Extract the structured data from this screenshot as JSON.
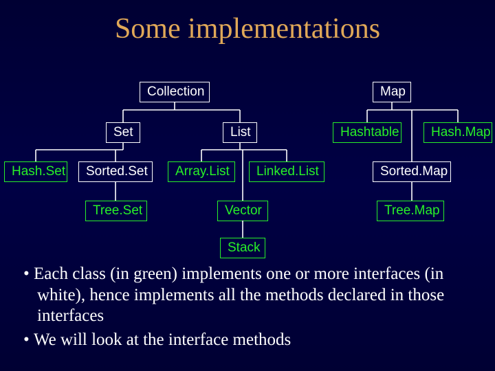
{
  "title": "Some implementations",
  "nodes": {
    "collection": "Collection",
    "map": "Map",
    "set": "Set",
    "list": "List",
    "hashset": "Hash.Set",
    "sortedset": "Sorted.Set",
    "arraylist": "Array.List",
    "linkedlist": "Linked.List",
    "treeset": "Tree.Set",
    "vector": "Vector",
    "stack": "Stack",
    "hashtable": "Hashtable",
    "hashmap": "Hash.Map",
    "sortedmap": "Sorted.Map",
    "treemap": "Tree.Map"
  },
  "bullets": [
    "Each class (in green) implements one or more interfaces (in white), hence implements all the methods declared in those interfaces",
    "We will look at the interface methods"
  ],
  "chart_data": {
    "type": "hierarchy",
    "legend": {
      "white": "interface",
      "green": "class"
    },
    "edges": [
      [
        "Collection",
        "Set"
      ],
      [
        "Collection",
        "List"
      ],
      [
        "Set",
        "Hash.Set"
      ],
      [
        "Set",
        "Sorted.Set"
      ],
      [
        "Sorted.Set",
        "Tree.Set"
      ],
      [
        "List",
        "Array.List"
      ],
      [
        "List",
        "Linked.List"
      ],
      [
        "List",
        "Vector"
      ],
      [
        "Vector",
        "Stack"
      ],
      [
        "Map",
        "Hashtable"
      ],
      [
        "Map",
        "Hash.Map"
      ],
      [
        "Map",
        "Sorted.Map"
      ],
      [
        "Sorted.Map",
        "Tree.Map"
      ]
    ],
    "interfaces": [
      "Collection",
      "Map",
      "Set",
      "List",
      "Sorted.Set",
      "Sorted.Map"
    ],
    "classes": [
      "Hash.Set",
      "Array.List",
      "Linked.List",
      "Tree.Set",
      "Vector",
      "Stack",
      "Hashtable",
      "Hash.Map",
      "Tree.Map"
    ]
  }
}
